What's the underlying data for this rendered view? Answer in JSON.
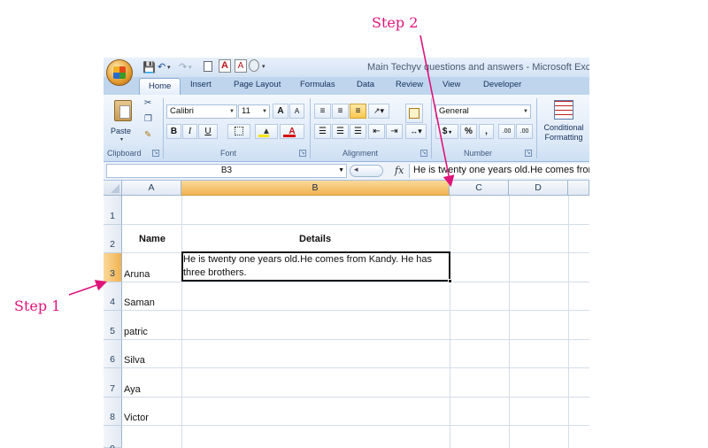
{
  "window": {
    "title": "Main Techyv questions and answers - Microsoft Excel"
  },
  "ribbon": {
    "tabs": [
      {
        "label": "Home",
        "active": true
      },
      {
        "label": "Insert"
      },
      {
        "label": "Page Layout"
      },
      {
        "label": "Formulas"
      },
      {
        "label": "Data"
      },
      {
        "label": "Review"
      },
      {
        "label": "View"
      },
      {
        "label": "Developer"
      }
    ],
    "clipboard": {
      "paste_label": "Paste",
      "group_label": "Clipboard"
    },
    "font": {
      "family": "Calibri",
      "size": "11",
      "group_label": "Font",
      "bold": "B",
      "italic": "I",
      "underline": "U",
      "grow": "A",
      "shrink": "A",
      "color": "A"
    },
    "alignment": {
      "group_label": "Alignment"
    },
    "number": {
      "format": "General",
      "group_label": "Number",
      "currency": "$",
      "percent": "%",
      "comma": ",",
      "inc_decimal": ".00",
      "dec_decimal": ".00"
    },
    "styles": {
      "conditional_formatting": "Conditional Formatting"
    }
  },
  "formula_bar": {
    "name_box": "B3",
    "fx_label": "fx",
    "formula": "He is twenty one years old.He comes from Kandy. He has three brothers."
  },
  "sheet": {
    "columns": [
      "A",
      "B",
      "C",
      "D"
    ],
    "selected_column": "B",
    "rows": [
      "1",
      "2",
      "3",
      "4",
      "5",
      "6",
      "7",
      "8",
      "9"
    ],
    "selected_row": "3",
    "header_name": "Name",
    "header_details": "Details",
    "names": [
      "Aruna",
      "Saman",
      "patric",
      "Silva",
      "Aya",
      "Victor"
    ],
    "active_cell_text": "He is twenty one years old.He comes from Kandy. He has three brothers."
  },
  "annotations": {
    "step1": "Step 1",
    "step2": "Step 2",
    "color": "#e0137a"
  }
}
